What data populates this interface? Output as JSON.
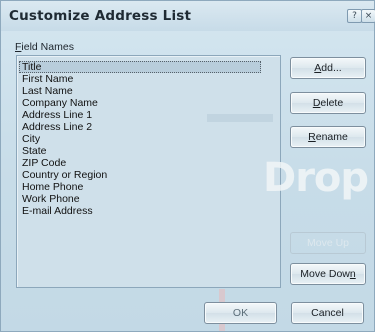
{
  "window": {
    "title": "Customize Address List",
    "help_label": "?",
    "close_label": "×"
  },
  "field_names": {
    "label_prefix": "",
    "label_mnemonic": "F",
    "label_rest": "ield Names",
    "items": [
      "Title",
      "First Name",
      "Last Name",
      "Company Name",
      "Address Line 1",
      "Address Line 2",
      "City",
      "State",
      "ZIP Code",
      "Country or Region",
      "Home Phone",
      "Work Phone",
      "E-mail Address"
    ],
    "selected_index": 0
  },
  "buttons": {
    "add_mnemonic": "A",
    "add_rest": "dd...",
    "delete_mnemonic": "D",
    "delete_rest": "elete",
    "rename_mnemonic": "R",
    "rename_rest": "ename",
    "move_up": "Move Up",
    "move_down_prefix": "Move Dow",
    "move_down_mnemonic": "n",
    "ok": "OK",
    "cancel": "Cancel"
  },
  "watermark": {
    "text": "Drop"
  },
  "colors": {
    "dialog_bg": "#c7dce8",
    "list_bg": "#cfe0ea",
    "selection": "#b8cddb"
  }
}
